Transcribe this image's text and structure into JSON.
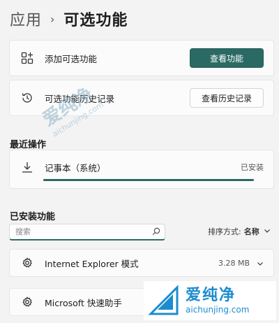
{
  "breadcrumb": {
    "parent": "应用",
    "separator": "›",
    "current": "可选功能"
  },
  "add_feature": {
    "label": "添加可选功能",
    "button": "查看功能"
  },
  "history": {
    "label": "可选功能历史记录",
    "button": "查看历史记录"
  },
  "recent": {
    "title": "最近操作",
    "item": {
      "label": "记事本（系统）",
      "status": "已安装",
      "progress": 1.0
    }
  },
  "installed": {
    "title": "已安装功能",
    "search_placeholder": "搜索",
    "sort_label": "排序方式:",
    "sort_value": "名称",
    "items": [
      {
        "label": "Internet Explorer 模式",
        "size": "3.28 MB"
      },
      {
        "label": "Microsoft 快速助手",
        "size": ""
      }
    ]
  },
  "watermark": {
    "text_big": "爱纯净",
    "text_small": "aichunjing.com"
  },
  "colors": {
    "accent": "#2b6a64",
    "watermark": "#1c8ccf"
  },
  "icons": [
    "grid-plus-icon",
    "history-icon",
    "download-icon",
    "search-icon",
    "gear-puzzle-icon",
    "chevron-down-icon"
  ]
}
